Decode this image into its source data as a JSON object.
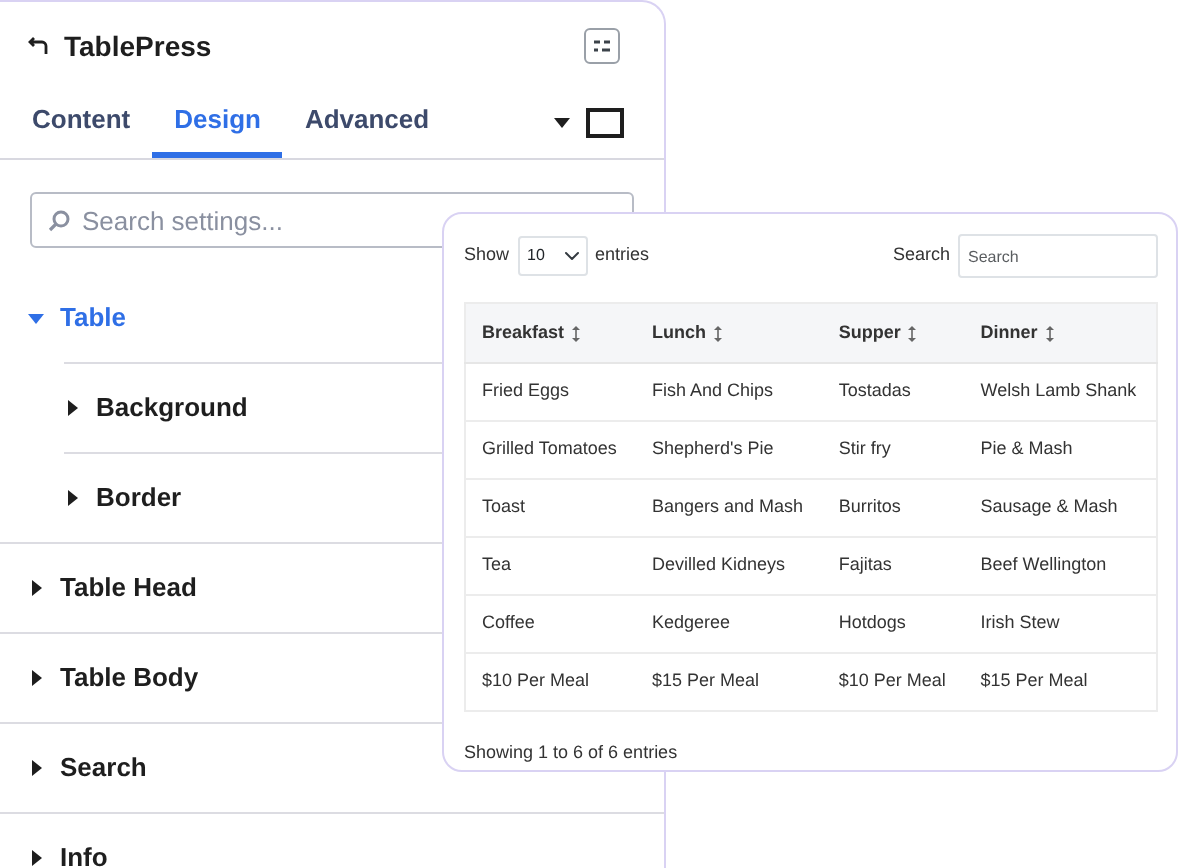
{
  "panel": {
    "title": "TablePress",
    "tabs": [
      {
        "label": "Content",
        "selected": false
      },
      {
        "label": "Design",
        "selected": true
      },
      {
        "label": "Advanced",
        "selected": false
      }
    ],
    "search": {
      "placeholder": "Search settings..."
    },
    "tree": [
      {
        "label": "Table",
        "expanded": true,
        "selected": true,
        "children": [
          {
            "label": "Background",
            "expanded": false,
            "selected": false
          },
          {
            "label": "Border",
            "expanded": false,
            "selected": false
          }
        ]
      },
      {
        "label": "Table Head",
        "expanded": false,
        "selected": false
      },
      {
        "label": "Table Body",
        "expanded": false,
        "selected": false
      },
      {
        "label": "Search",
        "expanded": false,
        "selected": false
      },
      {
        "label": "Info",
        "expanded": false,
        "selected": false
      }
    ]
  },
  "table_card": {
    "show_label": "Show",
    "length": "10",
    "entries_label": "entries",
    "search_label": "Search",
    "search_placeholder": "Search",
    "columns": [
      "Breakfast",
      "Lunch",
      "Supper",
      "Dinner"
    ],
    "rows": [
      [
        "Fried Eggs",
        "Fish And Chips",
        "Tostadas",
        "Welsh Lamb Shank"
      ],
      [
        "Grilled Tomatoes",
        "Shepherd's Pie",
        "Stir fry",
        "Pie & Mash"
      ],
      [
        "Toast",
        "Bangers and Mash",
        "Burritos",
        "Sausage & Mash"
      ],
      [
        "Tea",
        "Devilled Kidneys",
        "Fajitas",
        "Beef Wellington"
      ],
      [
        "Coffee",
        "Kedgeree",
        "Hotdogs",
        "Irish Stew"
      ],
      [
        "$10 Per Meal",
        "$15 Per Meal",
        "$10 Per Meal",
        "$15 Per Meal"
      ]
    ],
    "info": "Showing 1 to 6 of 6 entries"
  }
}
